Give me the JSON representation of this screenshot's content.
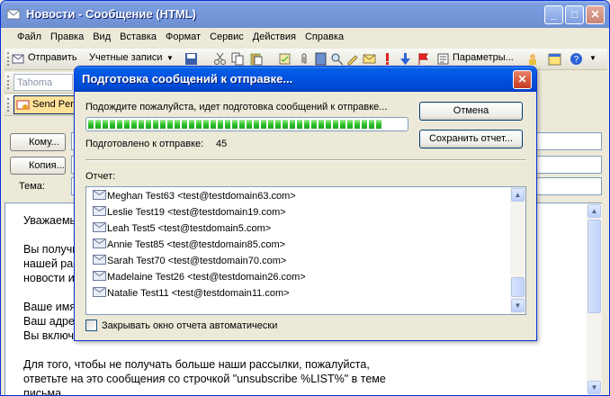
{
  "main_window": {
    "title": "Новости - Сообщение (HTML)",
    "buttons": {
      "minimize": "_",
      "maximize": "□",
      "close": "✕"
    }
  },
  "menu": [
    "Файл",
    "Правка",
    "Вид",
    "Вставка",
    "Формат",
    "Сервис",
    "Действия",
    "Справка"
  ],
  "toolbar": {
    "send_label": "Отправить",
    "accounts_label": "Учетные записи",
    "params_label": "Параметры..."
  },
  "format_bar": {
    "font": "Tahoma"
  },
  "plugin_bar": {
    "send_label": "Send Pers"
  },
  "fields": {
    "to_label": "Кому...",
    "cc_label": "Копия...",
    "subject_label": "Тема:"
  },
  "body_lines": [
    "Уважаемы",
    "",
    "Вы получи",
    "нашей рас",
    "новости и",
    "",
    "Ваше имя",
    "Ваш адрес",
    "Вы включе",
    "",
    "Для того, чтобы не получать больше наши рассылки, пожалуйста,",
    "ответьте на это сообщения со строчкой \"unsubscribe %LIST%\" в теме",
    "письма."
  ],
  "dialog": {
    "title": "Подготовка сообщений к отправке...",
    "message": "Подождите пожалуйста, идет подготовка сообщений к отправке...",
    "progress_fraction": 0.94,
    "prepared_label": "Подготовлено к отправке:",
    "prepared_count": "45",
    "cancel_label": "Отмена",
    "save_report_label": "Сохранить отчет...",
    "report_label": "Отчет:",
    "report_items": [
      "Meghan Test63 <test@testdomain63.com>",
      "Leslie Test19 <test@testdomain19.com>",
      "Leah Test5 <test@testdomain5.com>",
      "Annie Test85 <test@testdomain85.com>",
      "Sarah Test70 <test@testdomain70.com>",
      "Madelaine Test26 <test@testdomain26.com>",
      "Natalie Test11 <test@testdomain11.com>"
    ],
    "auto_close_label": "Закрывать окно отчета автоматически",
    "auto_close_checked": false
  }
}
